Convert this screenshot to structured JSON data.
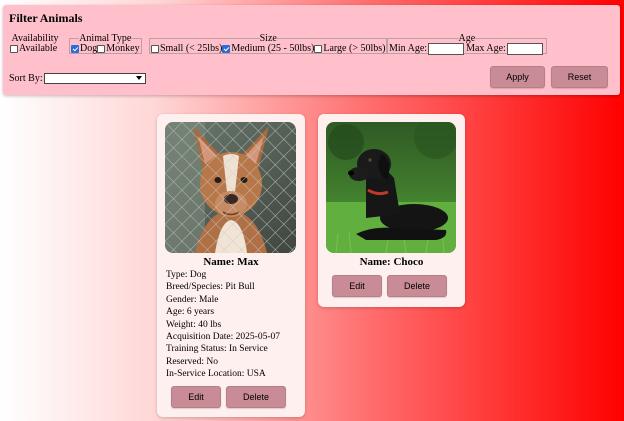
{
  "filters": {
    "title": "Filter Animals",
    "availability": {
      "legend": "Availability",
      "options": [
        {
          "label": "Available",
          "checked": false
        }
      ]
    },
    "animal_type": {
      "legend": "Animal Type",
      "options": [
        {
          "label": "Dog",
          "checked": true
        },
        {
          "label": "Monkey",
          "checked": false
        }
      ]
    },
    "size": {
      "legend": "Size",
      "options": [
        {
          "label": "Small (< 25lbs)",
          "checked": false
        },
        {
          "label": "Medium (25 - 50lbs)",
          "checked": true
        },
        {
          "label": "Large (> 50lbs)",
          "checked": false
        }
      ]
    },
    "age": {
      "legend": "Age",
      "min_label": "Min Age:",
      "min_value": "",
      "max_label": "Max Age:",
      "max_value": ""
    },
    "sort_by": {
      "label": "Sort By:",
      "selected": ""
    },
    "apply_label": "Apply",
    "reset_label": "Reset"
  },
  "animals": [
    {
      "name": "Name: Max",
      "details": [
        "Type: Dog",
        "Breed/Species: Pit Bull",
        "Gender: Male",
        "Age: 6 years",
        "Weight: 40 lbs",
        "Acquisition Date: 2025-05-07",
        "Training Status: In Service",
        "Reserved: No",
        "In-Service Location: USA"
      ],
      "edit_label": "Edit",
      "delete_label": "Delete"
    },
    {
      "name": "Name: Choco",
      "details": [],
      "edit_label": "Edit",
      "delete_label": "Delete"
    }
  ],
  "colors": {
    "panel_bg": "#ffc0cb",
    "button_bg": "#c98b96",
    "card_bg": "#fdf0ee",
    "checkbox_checked": "#2c6cd6"
  }
}
